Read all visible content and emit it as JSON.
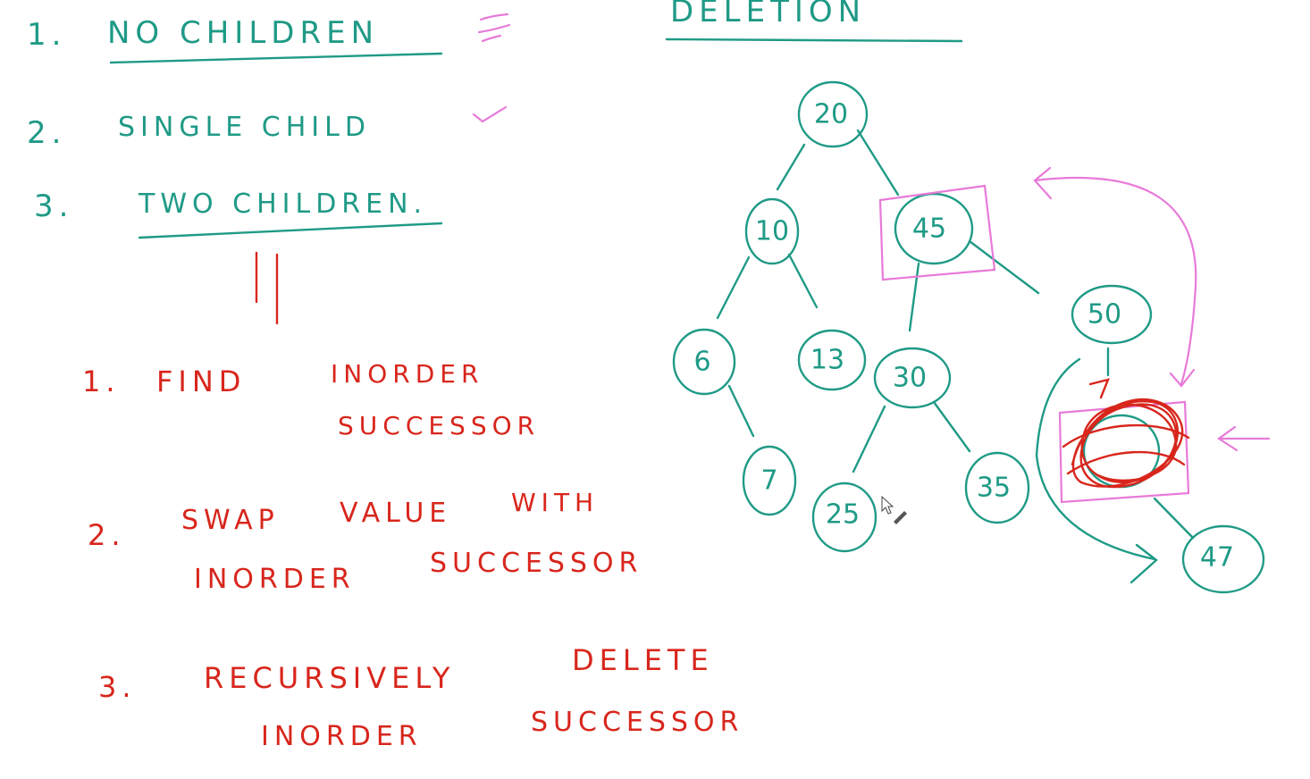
{
  "title": "DELETION",
  "cases": [
    {
      "num": "1.",
      "label": "NO CHILDREN"
    },
    {
      "num": "2.",
      "label": "SINGLE CHILD"
    },
    {
      "num": "3.",
      "label": "TWO CHILDREN."
    }
  ],
  "steps": [
    {
      "num": "1.",
      "line1": "FIND",
      "line1b": "INORDER",
      "line2": "SUCCESSOR"
    },
    {
      "num": "2.",
      "line1": "SWAP",
      "line1b": "VALUE",
      "line1c": "WITH",
      "line2": "INORDER",
      "line2b": "SUCCESSOR"
    },
    {
      "num": "3.",
      "line1": "RECURSIVELY",
      "line1b": "DELETE",
      "line2": "INORDER",
      "line2b": "SUCCESSOR"
    }
  ],
  "tree": {
    "nodes": [
      "20",
      "10",
      "45",
      "6",
      "13",
      "30",
      "7",
      "25",
      "35",
      "50",
      "47"
    ]
  },
  "colors": {
    "teal": "#1f9a86",
    "red": "#d8261c",
    "pink": "#e87ad8"
  }
}
